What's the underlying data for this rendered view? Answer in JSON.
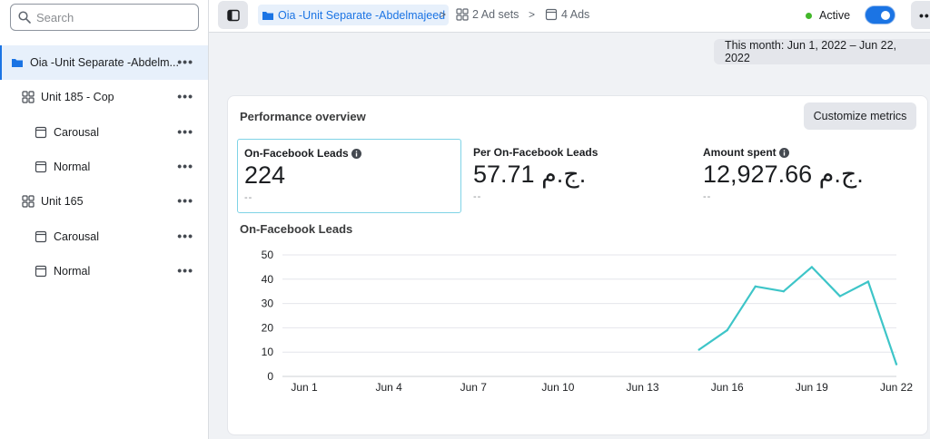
{
  "search": {
    "placeholder": "Search"
  },
  "sidebar": {
    "items": [
      {
        "label": "Oia -Unit Separate -Abdelm...",
        "type": "campaign"
      },
      {
        "label": "Unit 185 - Cop",
        "type": "adset"
      },
      {
        "label": "Carousal",
        "type": "ad"
      },
      {
        "label": "Normal",
        "type": "ad"
      },
      {
        "label": "Unit 165",
        "type": "adset"
      },
      {
        "label": "Carousal",
        "type": "ad"
      },
      {
        "label": "Normal",
        "type": "ad"
      }
    ],
    "more_label": "•••"
  },
  "topbar": {
    "campaign_crumb": "Oia -Unit Separate -Abdelmajeed",
    "adsets_crumb": "2 Ad sets",
    "ads_crumb": "4 Ads",
    "separator": ">",
    "status_label": "Active",
    "more_label": "•••"
  },
  "date_range": {
    "label": "This month: Jun 1, 2022 – Jun 22, 2022"
  },
  "overview": {
    "title": "Performance overview",
    "customize_label": "Customize metrics",
    "metrics": [
      {
        "label": "On-Facebook Leads",
        "value": "224",
        "compare": "--"
      },
      {
        "label": "Per On-Facebook Leads",
        "value": "57.71 ج.م.",
        "compare": "--"
      },
      {
        "label": "Amount spent",
        "value": "12,927.66 ج.م.",
        "compare": "--"
      }
    ]
  },
  "chart_data": {
    "type": "line",
    "title": "On-Facebook Leads",
    "x_tick_labels": [
      "Jun 1",
      "Jun 4",
      "Jun 7",
      "Jun 10",
      "Jun 13",
      "Jun 16",
      "Jun 19",
      "Jun 22"
    ],
    "y_ticks": [
      0,
      10,
      20,
      30,
      40,
      50
    ],
    "ylim": [
      0,
      50
    ],
    "xlim": [
      "Jun 1",
      "Jun 22"
    ],
    "series": [
      {
        "x": [
          "Jun 15",
          "Jun 16",
          "Jun 17",
          "Jun 18",
          "Jun 19",
          "Jun 20",
          "Jun 21",
          "Jun 22"
        ],
        "values": [
          11,
          19,
          37,
          35,
          45,
          33,
          39,
          5
        ]
      }
    ],
    "line_color": "#3ec5c8",
    "grid": true
  }
}
